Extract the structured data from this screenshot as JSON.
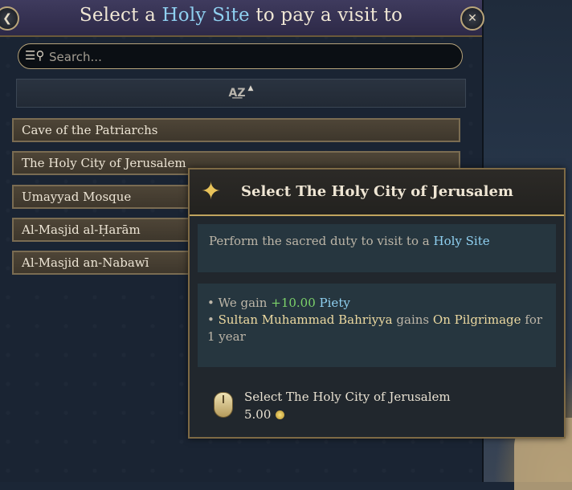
{
  "window": {
    "title_pre": "Select a",
    "title_highlight": "Holy Site",
    "title_post": "to pay a visit to"
  },
  "search": {
    "placeholder": "Search..."
  },
  "sort": {
    "icon": "sort-az-icon"
  },
  "sites": [
    "Cave of the Patriarchs",
    "The Holy City of Jerusalem",
    "Umayyad Mosque",
    "Al-Masjid al-Ḥarām",
    "Al-Masjid an-Nabawī"
  ],
  "tooltip": {
    "title": "Select The Holy City of Jerusalem",
    "desc_pre": "Perform the sacred duty to visit to a",
    "desc_highlight": "Holy Site",
    "effect1_pre": "We gain",
    "effect1_value": "+10.00",
    "effect1_stat": "Piety",
    "effect2_name": "Sultan Muhammad Bahriyya",
    "effect2_mid": "gains",
    "effect2_status": "On Pilgrimage",
    "effect2_post": "for 1 year",
    "action_label": "Select The Holy City of Jerusalem",
    "cost": "5.00"
  }
}
